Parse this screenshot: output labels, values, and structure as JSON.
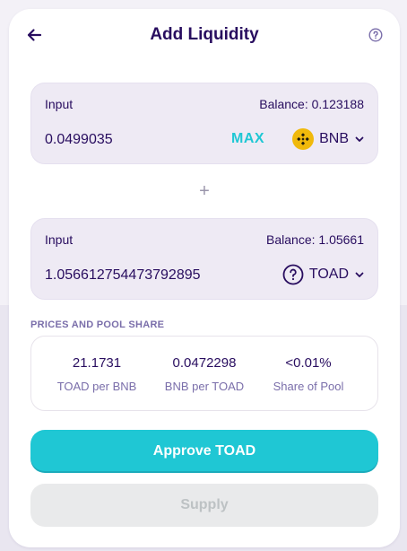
{
  "header": {
    "title": "Add Liquidity",
    "back_icon": "arrow-left-icon",
    "help_icon": "help-circle-icon"
  },
  "input_a": {
    "label": "Input",
    "balance": "Balance: 0.123188",
    "amount": "0.0499035",
    "max_label": "MAX",
    "token": "BNB",
    "token_icon": "bnb-logo-icon"
  },
  "separator": "+",
  "input_b": {
    "label": "Input",
    "balance": "Balance: 1.05661",
    "amount": "1.056612754473792895",
    "token": "TOAD",
    "token_icon": "unknown-token-icon"
  },
  "prices": {
    "section_title": "PRICES AND POOL SHARE",
    "items": [
      {
        "value": "21.1731",
        "label": "TOAD per BNB"
      },
      {
        "value": "0.0472298",
        "label": "BNB per TOAD"
      },
      {
        "value": "<0.01%",
        "label": "Share of Pool"
      }
    ]
  },
  "buttons": {
    "approve_label": "Approve TOAD",
    "supply_label": "Supply"
  },
  "colors": {
    "primary_text": "#280d5f",
    "secondary_text": "#7a6eaa",
    "accent": "#1fc7d4",
    "panel_bg": "#eeeaf4",
    "bnb_yellow": "#f0b90b",
    "disabled_bg": "#e9eaeb",
    "disabled_text": "#bdc2c4"
  }
}
